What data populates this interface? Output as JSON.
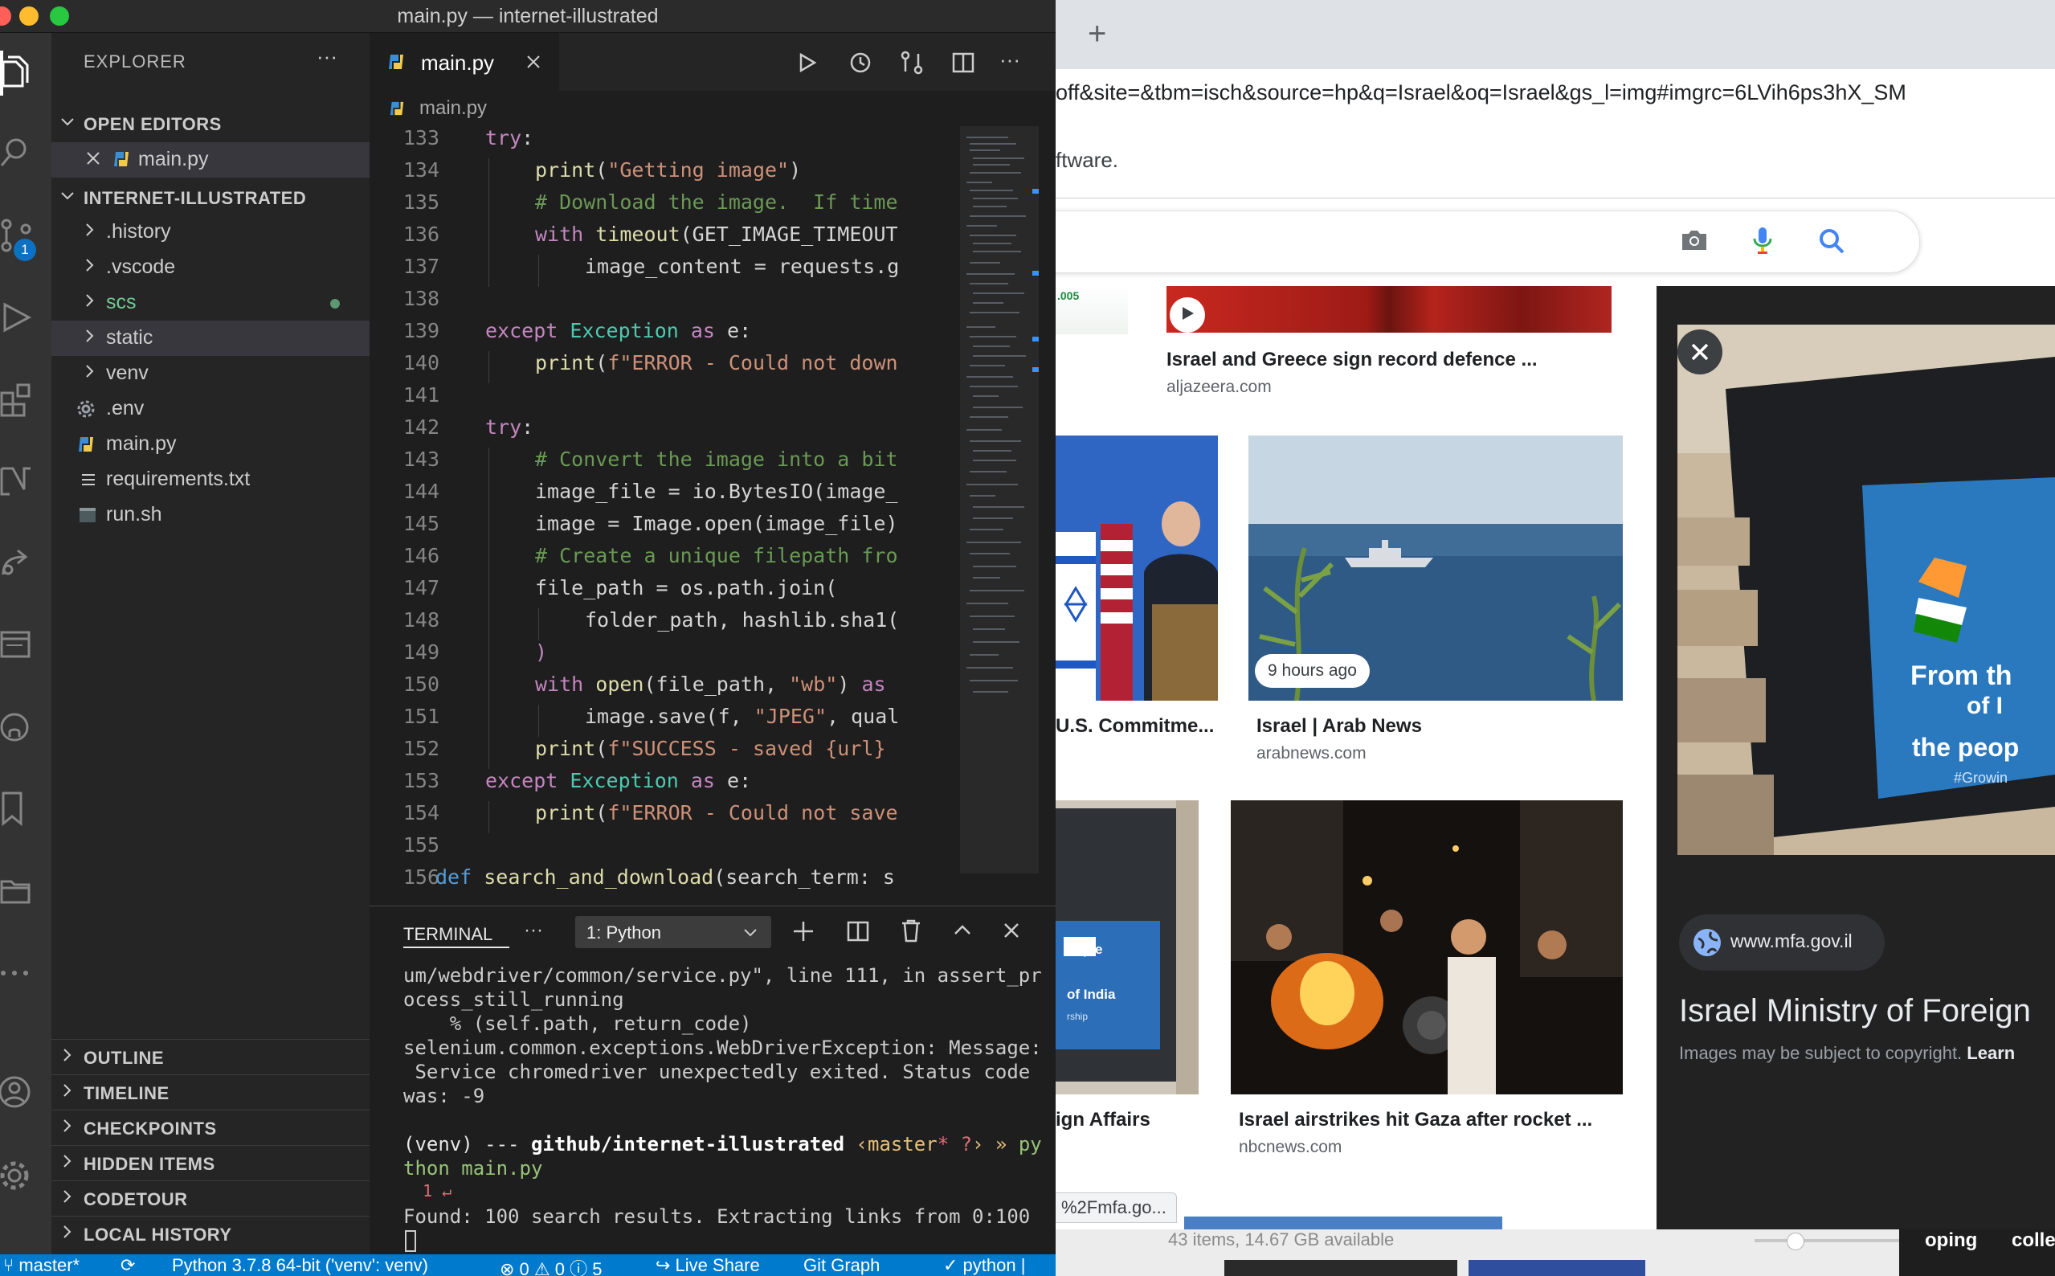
{
  "window": {
    "title": "main.py — internet-illustrated"
  },
  "activity": {
    "scm_badge": "1"
  },
  "explorer": {
    "header": "EXPLORER",
    "more": "···",
    "open_editors": "OPEN EDITORS",
    "open_file": "main.py",
    "project": "INTERNET-ILLUSTRATED",
    "tree": [
      ".history",
      ".vscode",
      "scs",
      "static",
      "venv",
      ".env",
      "main.py",
      "requirements.txt",
      "run.sh"
    ],
    "bottom": [
      "OUTLINE",
      "TIMELINE",
      "CHECKPOINTS",
      "HIDDEN ITEMS",
      "CODETOUR",
      "LOCAL HISTORY"
    ]
  },
  "editor": {
    "tab": "main.py",
    "breadcrumb": "main.py",
    "tab_more": "···",
    "lines": [
      {
        "n": "133",
        "indent": 1,
        "tokens": [
          [
            "kw",
            "try"
          ],
          [
            "p",
            ":"
          ]
        ]
      },
      {
        "n": "134",
        "indent": 2,
        "tokens": [
          [
            "fn",
            "print"
          ],
          [
            "p",
            "("
          ],
          [
            "str",
            "\"Getting image\""
          ],
          [
            "p",
            ")"
          ]
        ]
      },
      {
        "n": "135",
        "indent": 2,
        "tokens": [
          [
            "cm",
            "# Download the image.  If time"
          ]
        ]
      },
      {
        "n": "136",
        "indent": 2,
        "tokens": [
          [
            "kw",
            "with "
          ],
          [
            "fn",
            "timeout"
          ],
          [
            "p",
            "(GET_IMAGE_TIMEOUT"
          ]
        ]
      },
      {
        "n": "137",
        "indent": 3,
        "tokens": [
          [
            "p",
            "image_content = requests.g"
          ]
        ]
      },
      {
        "n": "138",
        "indent": 0,
        "tokens": []
      },
      {
        "n": "139",
        "indent": 1,
        "tokens": [
          [
            "kw",
            "except "
          ],
          [
            "cls",
            "Exception "
          ],
          [
            "kw",
            "as "
          ],
          [
            "p",
            "e:"
          ]
        ]
      },
      {
        "n": "140",
        "indent": 2,
        "tokens": [
          [
            "fn",
            "print"
          ],
          [
            "p",
            "("
          ],
          [
            "str",
            "f\"ERROR - Could not down"
          ]
        ]
      },
      {
        "n": "141",
        "indent": 0,
        "tokens": []
      },
      {
        "n": "142",
        "indent": 1,
        "tokens": [
          [
            "kw",
            "try"
          ],
          [
            "p",
            ":"
          ]
        ]
      },
      {
        "n": "143",
        "indent": 2,
        "tokens": [
          [
            "cm",
            "# Convert the image into a bit"
          ]
        ]
      },
      {
        "n": "144",
        "indent": 2,
        "tokens": [
          [
            "p",
            "image_file = io.BytesIO(image_"
          ]
        ]
      },
      {
        "n": "145",
        "indent": 2,
        "tokens": [
          [
            "p",
            "image = Image.open(image_file)"
          ]
        ]
      },
      {
        "n": "146",
        "indent": 2,
        "tokens": [
          [
            "cm",
            "# Create a unique filepath fro"
          ]
        ]
      },
      {
        "n": "147",
        "indent": 2,
        "tokens": [
          [
            "p",
            "file_path = os.path.join("
          ]
        ]
      },
      {
        "n": "148",
        "indent": 3,
        "tokens": [
          [
            "p",
            "folder_path, hashlib.sha1("
          ]
        ]
      },
      {
        "n": "149",
        "indent": 2,
        "tokens": [
          [
            "kw",
            ")"
          ]
        ]
      },
      {
        "n": "150",
        "indent": 2,
        "tokens": [
          [
            "kw",
            "with "
          ],
          [
            "fn",
            "open"
          ],
          [
            "p",
            "(file_path, "
          ],
          [
            "str",
            "\"wb\""
          ],
          [
            "p",
            ") "
          ],
          [
            "kw",
            "as "
          ]
        ]
      },
      {
        "n": "151",
        "indent": 3,
        "tokens": [
          [
            "p",
            "image.save(f, "
          ],
          [
            "str",
            "\"JPEG\""
          ],
          [
            "p",
            ", qual"
          ]
        ]
      },
      {
        "n": "152",
        "indent": 2,
        "tokens": [
          [
            "fn",
            "print"
          ],
          [
            "p",
            "("
          ],
          [
            "str",
            "f\"SUCCESS - saved {url} "
          ]
        ]
      },
      {
        "n": "153",
        "indent": 1,
        "tokens": [
          [
            "kw",
            "except "
          ],
          [
            "cls",
            "Exception "
          ],
          [
            "kw",
            "as "
          ],
          [
            "p",
            "e:"
          ]
        ]
      },
      {
        "n": "154",
        "indent": 2,
        "tokens": [
          [
            "fn",
            "print"
          ],
          [
            "p",
            "("
          ],
          [
            "str",
            "f\"ERROR - Could not save"
          ]
        ]
      },
      {
        "n": "155",
        "indent": 0,
        "tokens": []
      },
      {
        "n": "156",
        "indent": 0,
        "tokens": [
          [
            "kb",
            "def "
          ],
          [
            "fn",
            "search_and_download"
          ],
          [
            "p",
            "(search_term: s"
          ]
        ]
      }
    ]
  },
  "terminal": {
    "tab": "TERMINAL",
    "more": "···",
    "shell": "1: Python",
    "lines": [
      "um/webdriver/common/service.py\", line 111, in assert_pr",
      "ocess_still_running",
      "    % (self.path, return_code)",
      "selenium.common.exceptions.WebDriverException: Message:",
      " Service chromedriver unexpectedly exited. Status code",
      "was: -9",
      ""
    ],
    "prompt_venv": "(venv)",
    "prompt_sep": " --- ",
    "prompt_path": "github/internet-illustrated",
    "prompt_branch": " ‹master",
    "prompt_dirty": "* ?",
    "prompt_close": "› » ",
    "prompt_cmd1": "py",
    "prompt_cmd2": "thon main.py",
    "exit": "  1 ↵",
    "found": "Found: 100 search results. Extracting links from 0:100"
  },
  "statusbar": {
    "branch": "master*",
    "python": "Python 3.7.8 64-bit ('venv': venv)",
    "problems": "0 ⚠ 0 ⓘ 5",
    "liveshare": "Live Share",
    "gitgraph": "Git Graph",
    "lang": "✓ python |"
  },
  "browser": {
    "new_tab": "+",
    "url": "off&site=&tbm=isch&source=hp&q=Israel&oq=Israel&gs_l=img#imgrc=6LVih6ps3hX_SM",
    "info": "ftware.",
    "results": [
      {
        "title": "Israel and Greece sign record defence ...",
        "source": "aljazeera.com"
      },
      {
        "title": "U.S. Commitme...",
        "source": ""
      },
      {
        "title": "Israel | Arab News",
        "source": "arabnews.com",
        "badge": "9 hours ago"
      },
      {
        "title": "ign Affairs",
        "source": ""
      },
      {
        "title": "Israel airstrikes hit Gaza after rocket ...",
        "source": "nbcnews.com"
      }
    ],
    "thumb_banner": ".005",
    "israel_text_lines": [
      "eople",
      "of India",
      "rship"
    ],
    "status_url": "%2Fmfa.go...",
    "panel": {
      "image_text_lines": [
        "From th",
        "of I",
        "the peop",
        "#Growin"
      ],
      "site": "www.mfa.gov.il",
      "title": "Israel Ministry of Foreign",
      "copyright": "Images may be subject to copyright.",
      "learn": "Learn"
    }
  },
  "finder": {
    "status": "43 items, 14.67 GB available",
    "oping": "oping",
    "colle": "colle"
  }
}
